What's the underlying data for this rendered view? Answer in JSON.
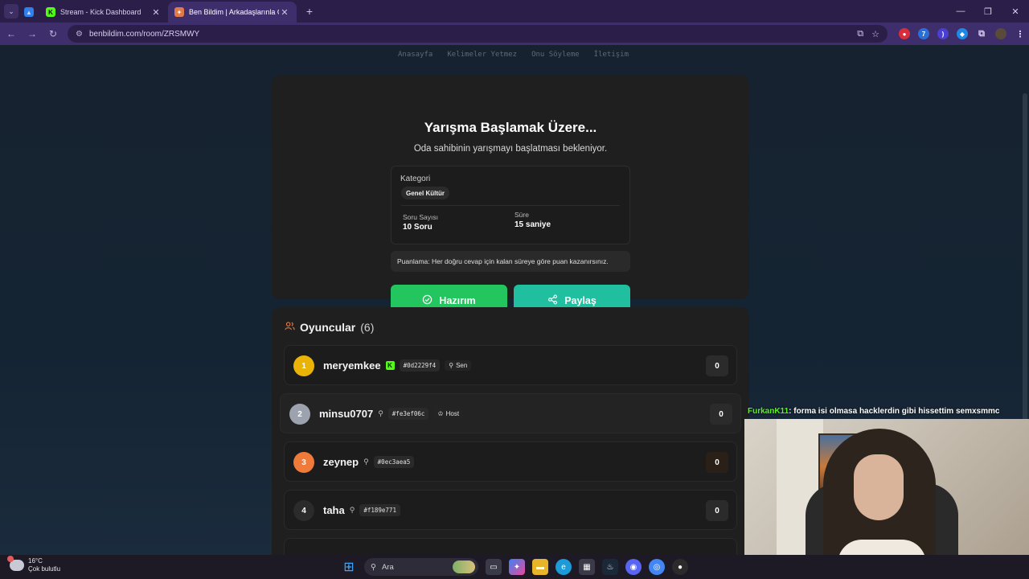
{
  "browser": {
    "tabs": [
      {
        "title": "",
        "favicon_color": "#2f80ed"
      },
      {
        "title": "Stream - Kick Dashboard",
        "favicon_color": "#53fc18"
      },
      {
        "title": "Ben Bildim | Arkadaşlarınla Onl",
        "favicon_color": "#e07a4a",
        "active": true
      }
    ],
    "url": "benbildim.com/room/ZRSMWY"
  },
  "nav": {
    "links": [
      "Anasayfa",
      "Kelimeler Yetmez",
      "Onu Söyleme",
      "İletişim"
    ]
  },
  "lobby": {
    "title": "Yarışma Başlamak Üzere...",
    "subtitle": "Oda sahibinin yarışmayı başlatması bekleniyor.",
    "category_label": "Kategori",
    "category_value": "Genel Kültür",
    "question_count_label": "Soru Sayısı",
    "question_count_value": "10 Soru",
    "duration_label": "Süre",
    "duration_value": "15 saniye",
    "scoring_note": "Puanlama: Her doğru cevap için kalan süreye göre puan kazanırsınız.",
    "ready_label": "Hazırım",
    "share_label": "Paylaş",
    "accent_green": "#22c55e",
    "accent_teal": "#1fbf9f"
  },
  "players": {
    "title": "Oyuncular",
    "count": "(6)",
    "list": [
      {
        "rank": "1",
        "name": "meryemkee",
        "tag": "#0d2229f4",
        "role": "Sen",
        "score": "0",
        "rank_color": "#eab308"
      },
      {
        "rank": "2",
        "name": "minsu0707",
        "tag": "#fe3ef06c",
        "role": "Host",
        "score": "0",
        "rank_color": "#9ca3af"
      },
      {
        "rank": "3",
        "name": "zeynep",
        "tag": "#0ec3aea5",
        "role": "",
        "score": "0",
        "rank_color": "#f07a3a"
      },
      {
        "rank": "4",
        "name": "taha",
        "tag": "#f189e771",
        "role": "",
        "score": "0",
        "rank_color": "#2b2b2b"
      }
    ]
  },
  "stream_overlay": {
    "chat_user": "FurkanK11",
    "chat_message": ": forma isi olmasa hacklerdin gibi hissettim semxsmmc"
  },
  "taskbar": {
    "temperature": "16°C",
    "weather": "Çok bulutlu",
    "search_placeholder": "Ara"
  }
}
